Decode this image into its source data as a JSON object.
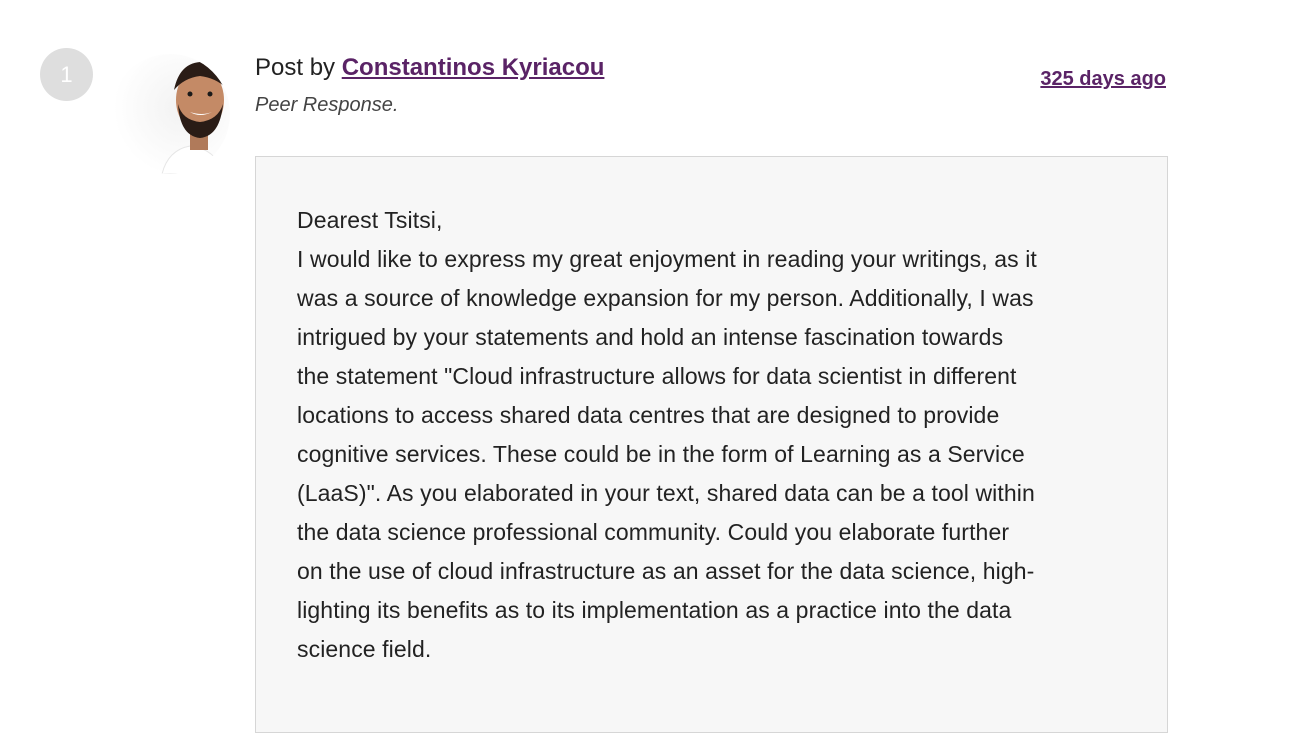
{
  "post": {
    "number": "1",
    "header_prefix": "Post by ",
    "author": "Constantinos Kyriacou",
    "subtitle": "Peer Response.",
    "time": "325 days ago",
    "greeting": "Dearest Tsitsi,",
    "lines": [
      "I would like to express my great enjoyment in reading your writings, as it",
      "was a source of knowledge expansion for my person. Additionally, I was",
      "intrigued by your statements and hold an intense fascination towards",
      "the statement \"Cloud infrastructure allows for data scientist in different",
      "locations to access shared data centres that are designed to provide",
      "cognitive services. These could be in the form of Learning as a Service",
      "(LaaS)\". As you elaborated in your text, shared data can be a tool within",
      "the data science professional community. Could you elaborate further",
      "on the use of cloud infrastructure as an asset for the data science, high-",
      "lighting its benefits as to its implementation as a practice into the data",
      "science field."
    ]
  },
  "colors": {
    "link": "#5a2366",
    "box_background": "#f7f7f7",
    "number_badge": "#dedede"
  }
}
